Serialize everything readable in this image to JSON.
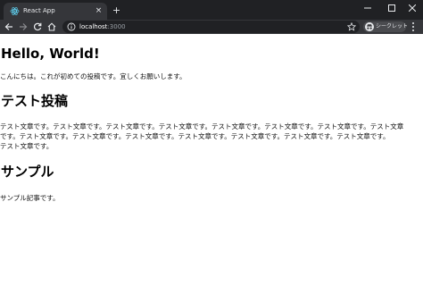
{
  "browser": {
    "tab_title": "React App",
    "tab_close": "×",
    "new_tab": "+",
    "url_host": "localhost",
    "url_port": ":3000",
    "incognito_label": "シークレット"
  },
  "page": {
    "heading1": "Hello, World!",
    "para1": "こんにちは。これが初めての投稿です。宜しくお願いします。",
    "heading2": "テスト投稿",
    "para2_lines": [
      "テスト文章です。テスト文章です。テスト文章です。テスト文章です。テスト文章です。テスト文章です。テスト文章です。テスト文章",
      "です。テスト文章です。テスト文章です。テスト文章です。テスト文章です。テスト文章です。テスト文章です。テスト文章です。",
      "テスト文章です。"
    ],
    "heading3": "サンプル",
    "para3": "サンプル記事です。"
  },
  "colors": {
    "titlebar": "#202124",
    "toolbar": "#35363a",
    "omnibox": "#202124",
    "page_bg": "#ffffff"
  }
}
